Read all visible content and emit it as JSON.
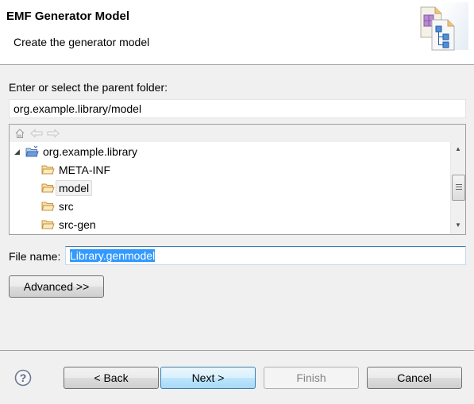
{
  "header": {
    "title": "EMF Generator Model",
    "subtitle": "Create the generator model",
    "banner_icon": "new-genmodel-wizard-icon"
  },
  "parent_folder": {
    "label": "Enter or select the parent folder:",
    "value": "org.example.library/model"
  },
  "tree_toolbar": {
    "home_icon": "home-icon",
    "back_icon": "back-arrow-icon",
    "forward_icon": "forward-arrow-icon"
  },
  "tree": {
    "root": {
      "label": "org.example.library",
      "expanded": true,
      "icon": "project-folder-icon"
    },
    "children": [
      {
        "label": "META-INF",
        "icon": "folder-icon",
        "selected": false
      },
      {
        "label": "model",
        "icon": "folder-icon",
        "selected": true
      },
      {
        "label": "src",
        "icon": "folder-icon",
        "selected": false
      },
      {
        "label": "src-gen",
        "icon": "folder-icon",
        "selected": false
      }
    ]
  },
  "file_name": {
    "label": "File name:",
    "value": "Library.genmodel"
  },
  "advanced_button": "Advanced >>",
  "footer": {
    "help_icon": "help-icon",
    "back": "< Back",
    "next": "Next >",
    "finish": "Finish",
    "cancel": "Cancel"
  }
}
